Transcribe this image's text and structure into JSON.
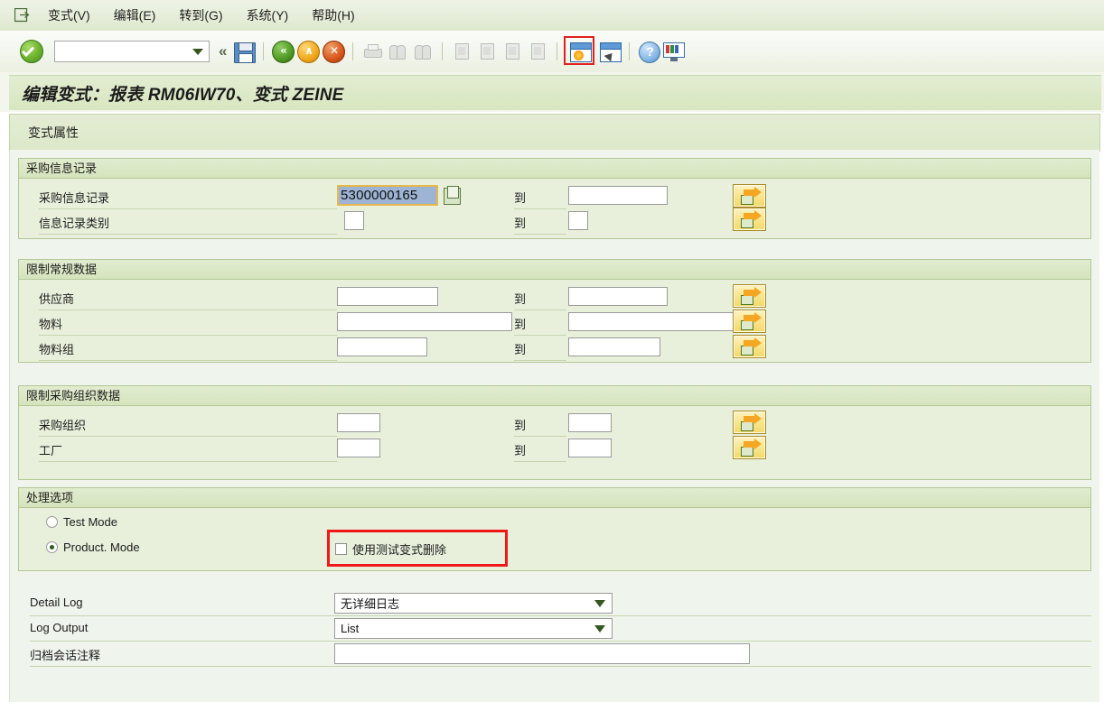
{
  "menu": {
    "system_icon": "sap-session-icon",
    "items": [
      {
        "label": "变式(V)",
        "accel": "V"
      },
      {
        "label": "编辑(E)",
        "accel": "E"
      },
      {
        "label": "转到(G)",
        "accel": "G"
      },
      {
        "label": "系统(Y)",
        "accel": "Y"
      },
      {
        "label": "帮助(H)",
        "accel": "H"
      }
    ]
  },
  "toolbar": {
    "command_value": "",
    "icons": [
      "enter-ok-icon",
      "save-icon",
      "back-icon",
      "exit-icon",
      "cancel-icon",
      "print-icon",
      "find-icon",
      "find-next-icon",
      "first-page-icon",
      "previous-page-icon",
      "next-page-icon",
      "last-page-icon",
      "create-variant-icon",
      "goto-variant-icon",
      "help-icon",
      "customize-local-layout-icon"
    ],
    "highlighted_icon": "create-variant-icon"
  },
  "header": {
    "title": "编辑变式：报表 RM06IW70、变式 ZEINE"
  },
  "tabs": [
    {
      "label": "变式属性",
      "active": true
    }
  ],
  "groups": [
    {
      "name": "purchasing-info-record",
      "title": "采购信息记录",
      "rows": [
        {
          "label": "采购信息记录",
          "from_value": "5300000165",
          "from_focused": true,
          "from_width": 112,
          "has_multi_icon": true,
          "to_label": "到",
          "to_value": "",
          "to_width": 110,
          "multiselect_button": "multiple-selection-button"
        },
        {
          "label": "信息记录类别",
          "from_value": "",
          "from_focused": false,
          "from_width": 22,
          "has_multi_icon": false,
          "to_label": "到",
          "to_value": "",
          "to_width": 22,
          "multiselect_button": "multiple-selection-button"
        }
      ]
    },
    {
      "name": "restrict-general-data",
      "title": "限制常规数据",
      "rows": [
        {
          "label": "供应商",
          "from_value": "",
          "from_focused": false,
          "from_width": 110,
          "has_multi_icon": false,
          "to_label": "到",
          "to_value": "",
          "to_width": 110,
          "multiselect_button": "multiple-selection-button"
        },
        {
          "label": "物料",
          "from_value": "",
          "from_focused": false,
          "from_width": 190,
          "has_multi_icon": false,
          "to_label": "到",
          "to_value": "",
          "to_width": 190,
          "multiselect_button": "multiple-selection-button"
        },
        {
          "label": "物料组",
          "from_value": "",
          "from_focused": false,
          "from_width": 100,
          "has_multi_icon": false,
          "to_label": "到",
          "to_value": "",
          "to_width": 100,
          "multiselect_button": "multiple-selection-button"
        }
      ]
    },
    {
      "name": "restrict-purchasing-org-data",
      "title": "限制采购组织数据",
      "rows": [
        {
          "label": "采购组织",
          "from_value": "",
          "from_focused": false,
          "from_width": 48,
          "has_multi_icon": false,
          "to_label": "到",
          "to_value": "",
          "to_width": 48,
          "multiselect_button": "multiple-selection-button"
        },
        {
          "label": "工厂",
          "from_value": "",
          "from_focused": false,
          "from_width": 48,
          "has_multi_icon": false,
          "to_label": "到",
          "to_value": "",
          "to_width": 48,
          "multiselect_button": "multiple-selection-button"
        }
      ]
    }
  ],
  "processing_options": {
    "title": "处理选项",
    "radios": [
      {
        "label": "Test Mode",
        "selected": false
      },
      {
        "label": "Product. Mode",
        "selected": true
      }
    ],
    "checkbox": {
      "label": "使用测试变式删除",
      "checked": false,
      "highlighted": true
    }
  },
  "bottom_fields": [
    {
      "label": "Detail Log",
      "type": "select",
      "value": "无详细日志"
    },
    {
      "label": "Log Output",
      "type": "select",
      "value": "List"
    },
    {
      "label": "归档会话注释",
      "type": "text",
      "value": ""
    }
  ],
  "colors": {
    "accent_green": "#4f9a23",
    "group_border": "#b2c795",
    "group_bg": "#e8f0dc",
    "page_bg": "#eff4ec",
    "highlight_red": "#f01818",
    "focus_border": "#e8b84b",
    "selection_blue": "#9db4d4",
    "button_yellow": "#f8e48c"
  }
}
